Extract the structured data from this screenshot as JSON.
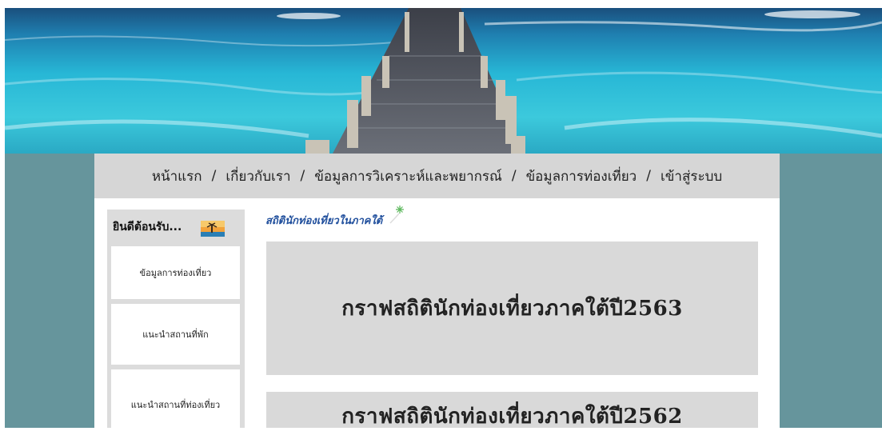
{
  "nav": {
    "items": [
      "หน้าแรก",
      "เกี่ยวกับเรา",
      "ข้อมูลการวิเคราะห์และพยากรณ์",
      "ข้อมูลการท่องเที่ยว",
      "เข้าสู่ระบบ"
    ],
    "separator": "/"
  },
  "sidebar": {
    "title": "ยินดีต้อนรับ...",
    "items": [
      {
        "label": "ข้อมูลการท่องเที่ยว"
      },
      {
        "label": "แนะนำสถานที่พัก"
      },
      {
        "label": "แนะนำสถานที่ท่องเที่ยว"
      }
    ]
  },
  "main": {
    "heading": "สถิตินักท่องเที่ยวในภาคใต้",
    "cards": [
      {
        "title": "กราฟสถิตินักท่องเที่ยวภาคใต้ปี2563"
      },
      {
        "title": "กราฟสถิตินักท่องเที่ยวภาคใต้ปี2562"
      }
    ]
  },
  "colors": {
    "page_background": "#66959c",
    "navbar": "#d6d6d6",
    "sidebar": "#dcdcdc",
    "card": "#d9d9d9",
    "heading": "#1f4e9c"
  },
  "icons": {
    "welcome": "beach-sunset-icon",
    "heading_decoration": "sparkle-icon"
  }
}
